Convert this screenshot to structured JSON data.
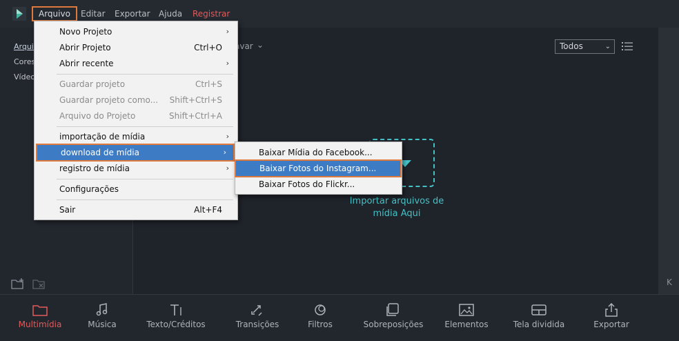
{
  "menubar": {
    "items": [
      {
        "label": "Arquivo"
      },
      {
        "label": "Editar"
      },
      {
        "label": "Exportar"
      },
      {
        "label": "Ajuda"
      },
      {
        "label": "Registrar"
      }
    ]
  },
  "left_panel": {
    "items": [
      {
        "label": "Arquiv"
      },
      {
        "label": "Cores"
      },
      {
        "label": "Vídeo"
      }
    ]
  },
  "center": {
    "partial_label": "avar",
    "filter_value": "Todos",
    "drop_label_line1": "Importar arquivos de",
    "drop_label_line2": "mídia Aqui"
  },
  "right_strip": {
    "mark": "K"
  },
  "file_menu": {
    "items": [
      {
        "label": "Novo Projeto",
        "shortcut": "",
        "submenu": true
      },
      {
        "label": "Abrir Projeto",
        "shortcut": "Ctrl+O",
        "submenu": false
      },
      {
        "label": "Abrir recente",
        "shortcut": "",
        "submenu": true
      },
      {
        "label": "Guardar projeto",
        "shortcut": "Ctrl+S",
        "submenu": false,
        "disabled": true
      },
      {
        "label": "Guardar projeto como...",
        "shortcut": "Shift+Ctrl+S",
        "submenu": false,
        "disabled": true
      },
      {
        "label": "Arquivo do Projeto",
        "shortcut": "Shift+Ctrl+A",
        "submenu": false,
        "disabled": true
      },
      {
        "label": "importação de mídia",
        "shortcut": "",
        "submenu": true
      },
      {
        "label": "download de mídia",
        "shortcut": "",
        "submenu": true,
        "highlighted": true
      },
      {
        "label": "registro de mídia",
        "shortcut": "",
        "submenu": true
      },
      {
        "label": "Configurações",
        "shortcut": "",
        "submenu": false
      },
      {
        "label": "Sair",
        "shortcut": "Alt+F4",
        "submenu": false
      }
    ],
    "submenu_arrow": "›"
  },
  "download_submenu": {
    "items": [
      {
        "label": "Baixar Mídia do Facebook..."
      },
      {
        "label": "Baixar Fotos do Instagram...",
        "highlighted": true
      },
      {
        "label": "Baixar Fotos do Flickr..."
      }
    ]
  },
  "bottom_toolbar": {
    "tools": [
      {
        "label": "Multimídia",
        "icon": "folder-icon",
        "active": true
      },
      {
        "label": "Música",
        "icon": "music-note-icon"
      },
      {
        "label": "Texto/Créditos",
        "icon": "text-icon"
      },
      {
        "label": "Transições",
        "icon": "transition-icon"
      },
      {
        "label": "Filtros",
        "icon": "filter-icon"
      },
      {
        "label": "Sobreposições",
        "icon": "overlay-icon"
      },
      {
        "label": "Elementos",
        "icon": "image-icon"
      },
      {
        "label": "Tela dividida",
        "icon": "split-screen-icon"
      },
      {
        "label": "Exportar",
        "icon": "export-icon"
      }
    ]
  },
  "colors": {
    "accent_highlight": "#3d7cc4",
    "outline_orange": "#e07a3c",
    "active_red": "#e25b5b",
    "drop_teal": "#45c2c6"
  }
}
